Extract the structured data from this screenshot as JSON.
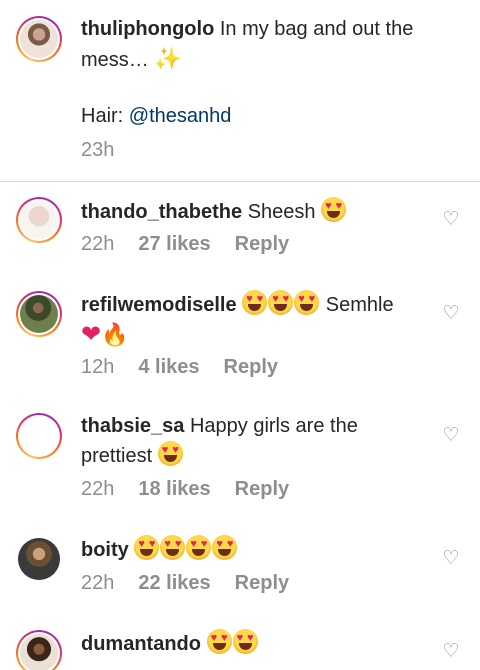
{
  "caption": {
    "username": "thuliphongolo",
    "text": "In my bag and out the mess…",
    "sparkle_icon": "sparkles-icon",
    "hair_label": "Hair:",
    "hair_mention": "@thesanhd",
    "time": "23h"
  },
  "comments": [
    {
      "username": "thando_thabethe",
      "text": "Sheesh",
      "time": "22h",
      "likes": "27 likes",
      "reply": "Reply"
    },
    {
      "username": "refilwemodiselle",
      "text": "Semhle",
      "time": "12h",
      "likes": "4 likes",
      "reply": "Reply"
    },
    {
      "username": "thabsie_sa",
      "text": "Happy girls are the",
      "text2": "prettiest",
      "time": "22h",
      "likes": "18 likes",
      "reply": "Reply"
    },
    {
      "username": "boity",
      "text": "",
      "time": "22h",
      "likes": "22 likes",
      "reply": "Reply"
    },
    {
      "username": "dumantando",
      "text": "",
      "time": "",
      "likes": "",
      "reply": ""
    }
  ],
  "colors": {
    "text": "#262626",
    "muted": "#8e8e8e",
    "mention": "#00376b",
    "divider": "#dbdbdb"
  },
  "icons": {
    "like": "heart-outline-icon",
    "emoji": "heart-eyes-emoji-icon"
  }
}
